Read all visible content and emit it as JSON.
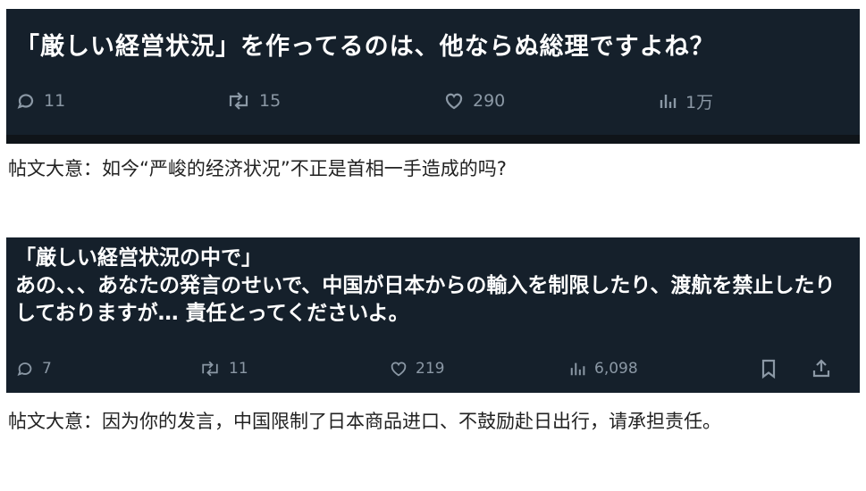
{
  "post1": {
    "text": "「厳しい経営状況」を作ってるのは、他ならぬ総理ですよね？",
    "replies": "11",
    "reposts": "15",
    "likes": "290",
    "views": "1万",
    "icons": [
      "reply-icon",
      "repost-icon",
      "like-icon",
      "views-icon"
    ]
  },
  "caption1": "帖文大意：如今“严峻的经济状况”不正是首相一手造成的吗?",
  "post2": {
    "text": "「厳しい経営状況の中で」\nあの、、、あなたの発言のせいで、中国が日本からの輸入を制限したり、渡航を禁止したりしておりますが… 責任とってくださいよ。",
    "replies": "7",
    "reposts": "11",
    "likes": "219",
    "views": "6,098",
    "icons": [
      "reply-icon",
      "repost-icon",
      "like-icon",
      "views-icon",
      "bookmark-icon",
      "share-icon"
    ]
  },
  "caption2": "帖文大意：因为你的发言，中国限制了日本商品进口、不鼓励赴日出行，请承担责任。",
  "colors": {
    "post_bg": "#15202b",
    "muted": "#8b98a5",
    "text": "#ffffff"
  }
}
